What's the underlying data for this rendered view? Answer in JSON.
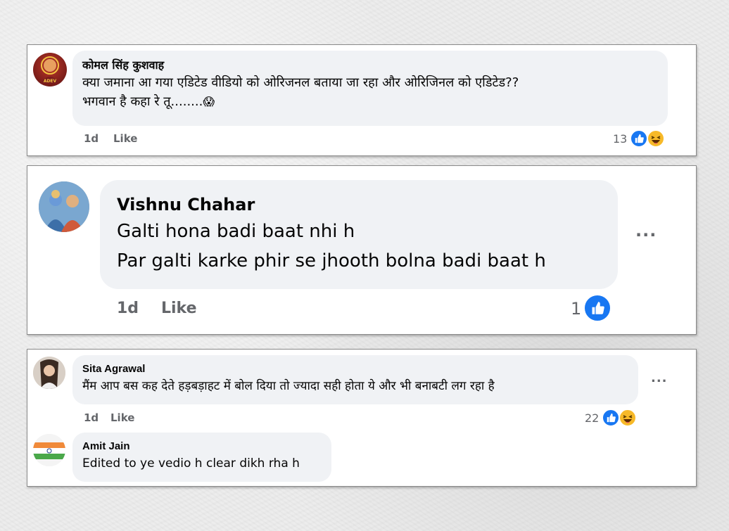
{
  "comments": [
    {
      "author": "कोमल सिंह कुशवाह",
      "avatar_text": "ADEV",
      "lines": [
        "क्या जमाना आ गया एडिटेड वीडियो को ओरिजनल बताया जा रहा और ओरिजिनल को एडिटेड??",
        "भगवान है कहा रे तू........"
      ],
      "emoji": "😱",
      "time": "1d",
      "like_label": "Like",
      "reaction_count": "13",
      "reactions": [
        "like-icon",
        "haha-icon"
      ]
    },
    {
      "author": "Vishnu Chahar",
      "lines": [
        "Galti hona badi baat nhi h",
        "Par galti karke phir se jhooth bolna badi baat h"
      ],
      "time": "1d",
      "like_label": "Like",
      "reaction_count": "1",
      "reactions": [
        "like-icon"
      ],
      "more_label": "..."
    },
    {
      "author": "Sita Agrawal",
      "lines": [
        "मैंम आप बस कह देते हड़बड़ाहट में बोल दिया तो ज्यादा सही होता ये और भी बनाबटी लग रहा है"
      ],
      "time": "1d",
      "like_label": "Like",
      "reaction_count": "22",
      "reactions": [
        "like-icon",
        "haha-icon"
      ],
      "more_label": "..."
    },
    {
      "author": "Amit Jain",
      "lines": [
        "Edited to ye vedio h clear dikh rha h"
      ]
    }
  ],
  "colors": {
    "like_blue": "#1877f2",
    "haha_yellow": "#f7b928",
    "bubble_bg": "#f0f2f5",
    "meta_gray": "#65676b"
  }
}
